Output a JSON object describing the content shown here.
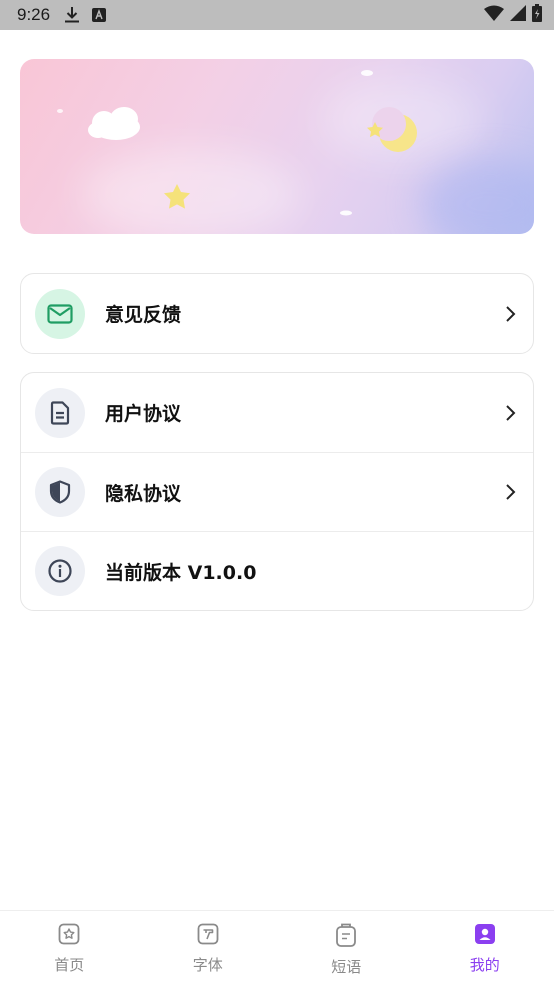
{
  "statusbar": {
    "time": "9:26",
    "icons": [
      "download-icon",
      "a-badge-icon",
      "wifi-icon",
      "signal-icon",
      "battery-icon"
    ]
  },
  "banner": {
    "decorations": [
      "cloud",
      "moon",
      "star",
      "star"
    ]
  },
  "menu": {
    "feedback": {
      "label": "意见反馈",
      "icon": "mail-icon",
      "icon_bg": "#d6f5e4",
      "icon_color": "#1f9d63"
    },
    "user_agreement": {
      "label": "用户协议",
      "icon": "document-icon"
    },
    "privacy_agreement": {
      "label": "隐私协议",
      "icon": "shield-icon"
    },
    "version": {
      "label": "当前版本 V1.0.0",
      "icon": "info-icon"
    }
  },
  "tabbar": {
    "tabs": [
      {
        "label": "首页",
        "icon": "home-star-icon",
        "active": false
      },
      {
        "label": "字体",
        "icon": "font-icon",
        "active": false
      },
      {
        "label": "短语",
        "icon": "phrase-icon",
        "active": false
      },
      {
        "label": "我的",
        "icon": "profile-icon",
        "active": true
      }
    ],
    "active_color": "#8b3ff0",
    "inactive_color": "#8a8a8a"
  }
}
